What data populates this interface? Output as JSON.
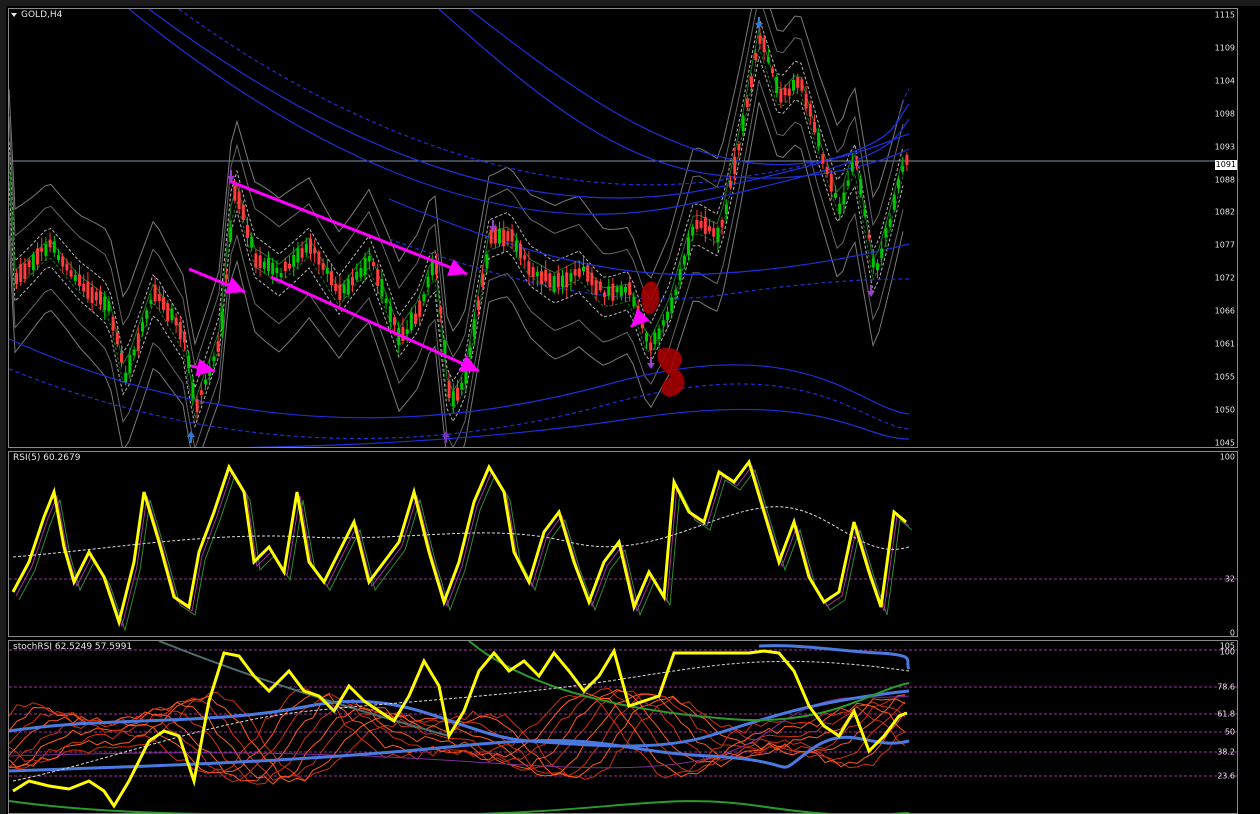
{
  "window": {
    "symbol_label": "GOLD,H4"
  },
  "price_axis": {
    "ticks": [
      "1115",
      "1109",
      "1104",
      "1098",
      "1093",
      "1088",
      "1082",
      "1077",
      "1072",
      "1066",
      "1061",
      "1055",
      "1050",
      "1045"
    ],
    "current_price_tag": "1091"
  },
  "rsi_panel": {
    "label": "RSI(5) 60.2679",
    "ticks": [
      "100",
      "32",
      "0"
    ]
  },
  "stoch_panel": {
    "label": "stochRSI 62.5249 57.5991",
    "ticks": [
      "105",
      "100",
      "78.6",
      "61.8",
      "50",
      "38.2",
      "23.6"
    ]
  },
  "colors": {
    "background": "#000000",
    "bull_candle": "#00c800",
    "bear_candle": "#ff3b3b",
    "band_outer": "#1e2fd8",
    "band_gray": "#8a8a8a",
    "trendline": "#ff00ff",
    "rsi_line": "#ffff00",
    "reference_dash": "#a02fa0",
    "annotation": "#b00000"
  },
  "icons": {
    "arrow_up": "up-arrow-icon",
    "arrow_down": "down-arrow-icon",
    "dropdown": "triangle-down-icon"
  }
}
